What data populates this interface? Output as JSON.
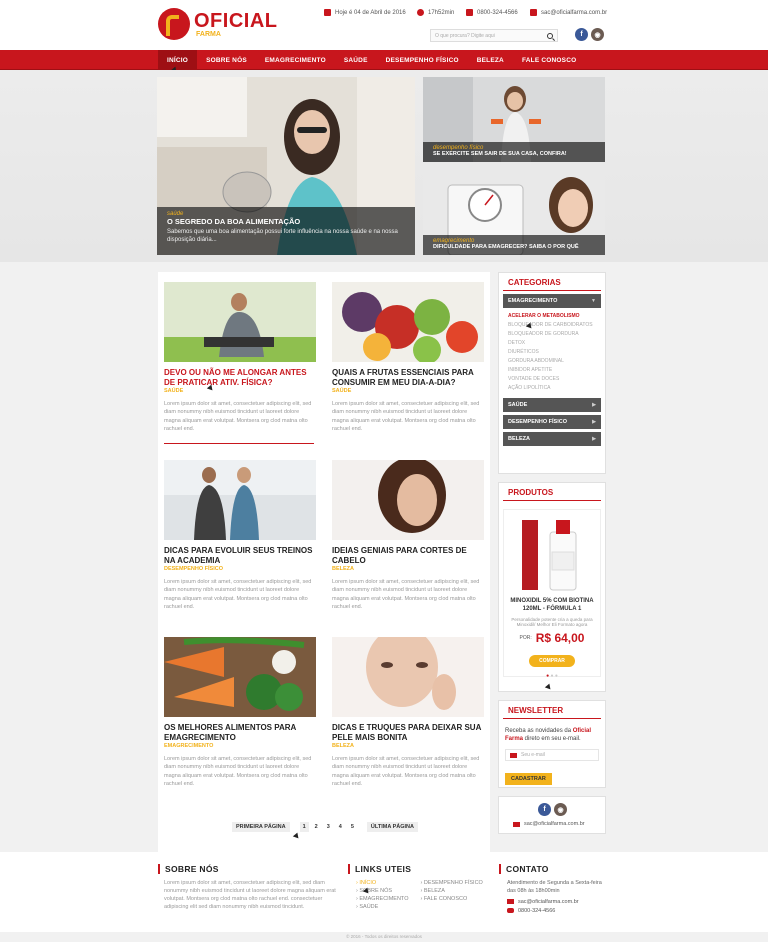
{
  "header": {
    "logo_name": "OFICIAL",
    "logo_sub": "FARMA",
    "date": "Hoje é 04 de Abril de 2016",
    "time": "17h52min",
    "phone": "0800-324-4566",
    "email": "sac@oficialfarma.com.br",
    "search_placeholder": "O que procura? Digite aqui",
    "brand_color": "#c8161d",
    "accent_color": "#f2b21c"
  },
  "nav": [
    "INÍCIO",
    "SOBRE NÓS",
    "EMAGRECIMENTO",
    "SAÚDE",
    "DESEMPENHO FÍSICO",
    "BELEZA",
    "FALE CONOSCO"
  ],
  "hero": {
    "main": {
      "category": "saúde",
      "title": "O SEGREDO DA BOA ALIMENTAÇÃO",
      "desc": "Sabemos que uma boa alimentação possui forte influência na nossa saúde e na nossa disposição diária..."
    },
    "side1": {
      "category": "desempenho físico",
      "title": "SE EXERCITE SEM SAIR DE SUA CASA, CONFIRA!"
    },
    "side2": {
      "category": "emagrecimento",
      "title": "DIFICULDADE PARA EMAGRECER? SAIBA O POR QUÊ"
    }
  },
  "articles": [
    {
      "title": "DEVO OU NÃO ME ALONGAR ANTES DE PRATICAR ATIV. FÍSICA?",
      "category": "SAÚDE",
      "text": "Lorem ipsum dolor sit amet, consectetuer adipiscing elit, sed diam nonummy nibh euismod tincidunt ut laoreet dolore magna aliquam erat volutpat. Montsera org clod matna olto rachuel end."
    },
    {
      "title": "QUAIS A FRUTAS ESSENCIAIS PARA CONSUMIR EM MEU DIA-A-DIA?",
      "category": "SAÚDE",
      "text": "Lorem ipsum dolor sit amet, consectetuer adipiscing elit, sed diam nonummy nibh euismod tincidunt ut laoreet dolore magna aliquam erat volutpat. Montsera org clod matna olto rachuel end."
    },
    {
      "title": "DICAS PARA EVOLUIR SEUS TREINOS NA ACADEMIA",
      "category": "DESEMPENHO FÍSICO",
      "text": "Lorem ipsum dolor sit amet, consectetuer adipiscing elit, sed diam nonummy nibh euismod tincidunt ut laoreet dolore magna aliquam erat volutpat. Montsera org clod matna olto rachuel end."
    },
    {
      "title": "IDEIAS GENIAIS PARA CORTES DE CABELO",
      "category": "BELEZA",
      "text": "Lorem ipsum dolor sit amet, consectetuer adipiscing elit, sed diam nonummy nibh euismod tincidunt ut laoreet dolore magna aliquam erat volutpat. Montsera org clod matna olto rachuel end."
    },
    {
      "title": "OS MELHORES ALIMENTOS PARA EMAGRECIMENTO",
      "category": "EMAGRECIMENTO",
      "text": "Lorem ipsum dolor sit amet, consectetuer adipiscing elit, sed diam nonummy nibh euismod tincidunt ut laoreet dolore magna aliquam erat volutpat. Montsera org clod matna olto rachuel end."
    },
    {
      "title": "DICAS E TRUQUES PARA DEIXAR SUA PELE MAIS BONITA",
      "category": "BELEZA",
      "text": "Lorem ipsum dolor sit amet, consectetuer adipiscing elit, sed diam nonummy nibh euismod tincidunt ut laoreet dolore magna aliquam erat volutpat. Montsera org clod matna olto rachuel end."
    }
  ],
  "pagination": {
    "first": "PRIMEIRA PÁGINA",
    "pages": [
      "1",
      "2",
      "3",
      "4",
      "5"
    ],
    "last": "ÚLTIMA PÁGINA"
  },
  "sidebar": {
    "categories_title": "CATEGORIAS",
    "categories": [
      "EMAGRECIMENTO",
      "SAÚDE",
      "DESEMPENHO FÍSICO",
      "BELEZA"
    ],
    "subcategories": [
      "ACELERAR O METABOLISMO",
      "BLOQUEADOR DE CARBOIDRATOS",
      "BLOQUEADOR DE GORDURA",
      "DETOX",
      "DIURÉTICOS",
      "GORDURA ABDOMINAL",
      "INIBIDOR APETITE",
      "VONTADE DE DOCES",
      "AÇÃO LIPOLÍTICA"
    ],
    "products_title": "PRODUTOS",
    "product": {
      "label": "MINOXIDIL 5% COM BIOTINA",
      "name": "MINOXIDIL 5% COM BIOTINA 120ML - FÓRMULA 1",
      "desc": "Personalidade potente cria a queda para Minoxidil/ Melhor Eli Formato agora",
      "price_prefix": "POR:",
      "price": "R$ 64,00",
      "buy": "COMPRAR"
    },
    "newsletter_title": "NEWSLETTER",
    "newsletter_text_1": "Receba as novidades da ",
    "newsletter_brand": "Oficial Farma",
    "newsletter_text_2": " direto em seu e-mail.",
    "email_placeholder": "Seu e-mail",
    "subscribe": "CADASTRAR",
    "contact_email": "sac@oficialfarma.com.br"
  },
  "footer": {
    "about_title": "SOBRE NÓS",
    "about_text": "Lorem ipsum dolor sit amet, consectetuer adipiscing elit, sed diam nonummy nibh euismod tincidunt ut laoreet dolore magna aliquam erat volutpat. Montsera org clod matna olto rachuel end. consectetuer adipiscing elit sed diam nonummy nibh euismod tincidunt.",
    "links_title": "LINKS UTEIS",
    "links_col1": [
      "INÍCIO",
      "SOBRE NÓS",
      "EMAGRECIMENTO",
      "SAÚDE"
    ],
    "links_col2": [
      "DESEMPENHO FÍSICO",
      "BELEZA",
      "FALE CONOSCO"
    ],
    "contact_title": "CONTATO",
    "hours": "Atendimento de Segunda a Sexta-feira das 08h às 18h00min",
    "email": "sac@oficialfarma.com.br",
    "phone": "0800-324-4566",
    "copyright": "© 2016 - Todos os direitos reservados"
  }
}
